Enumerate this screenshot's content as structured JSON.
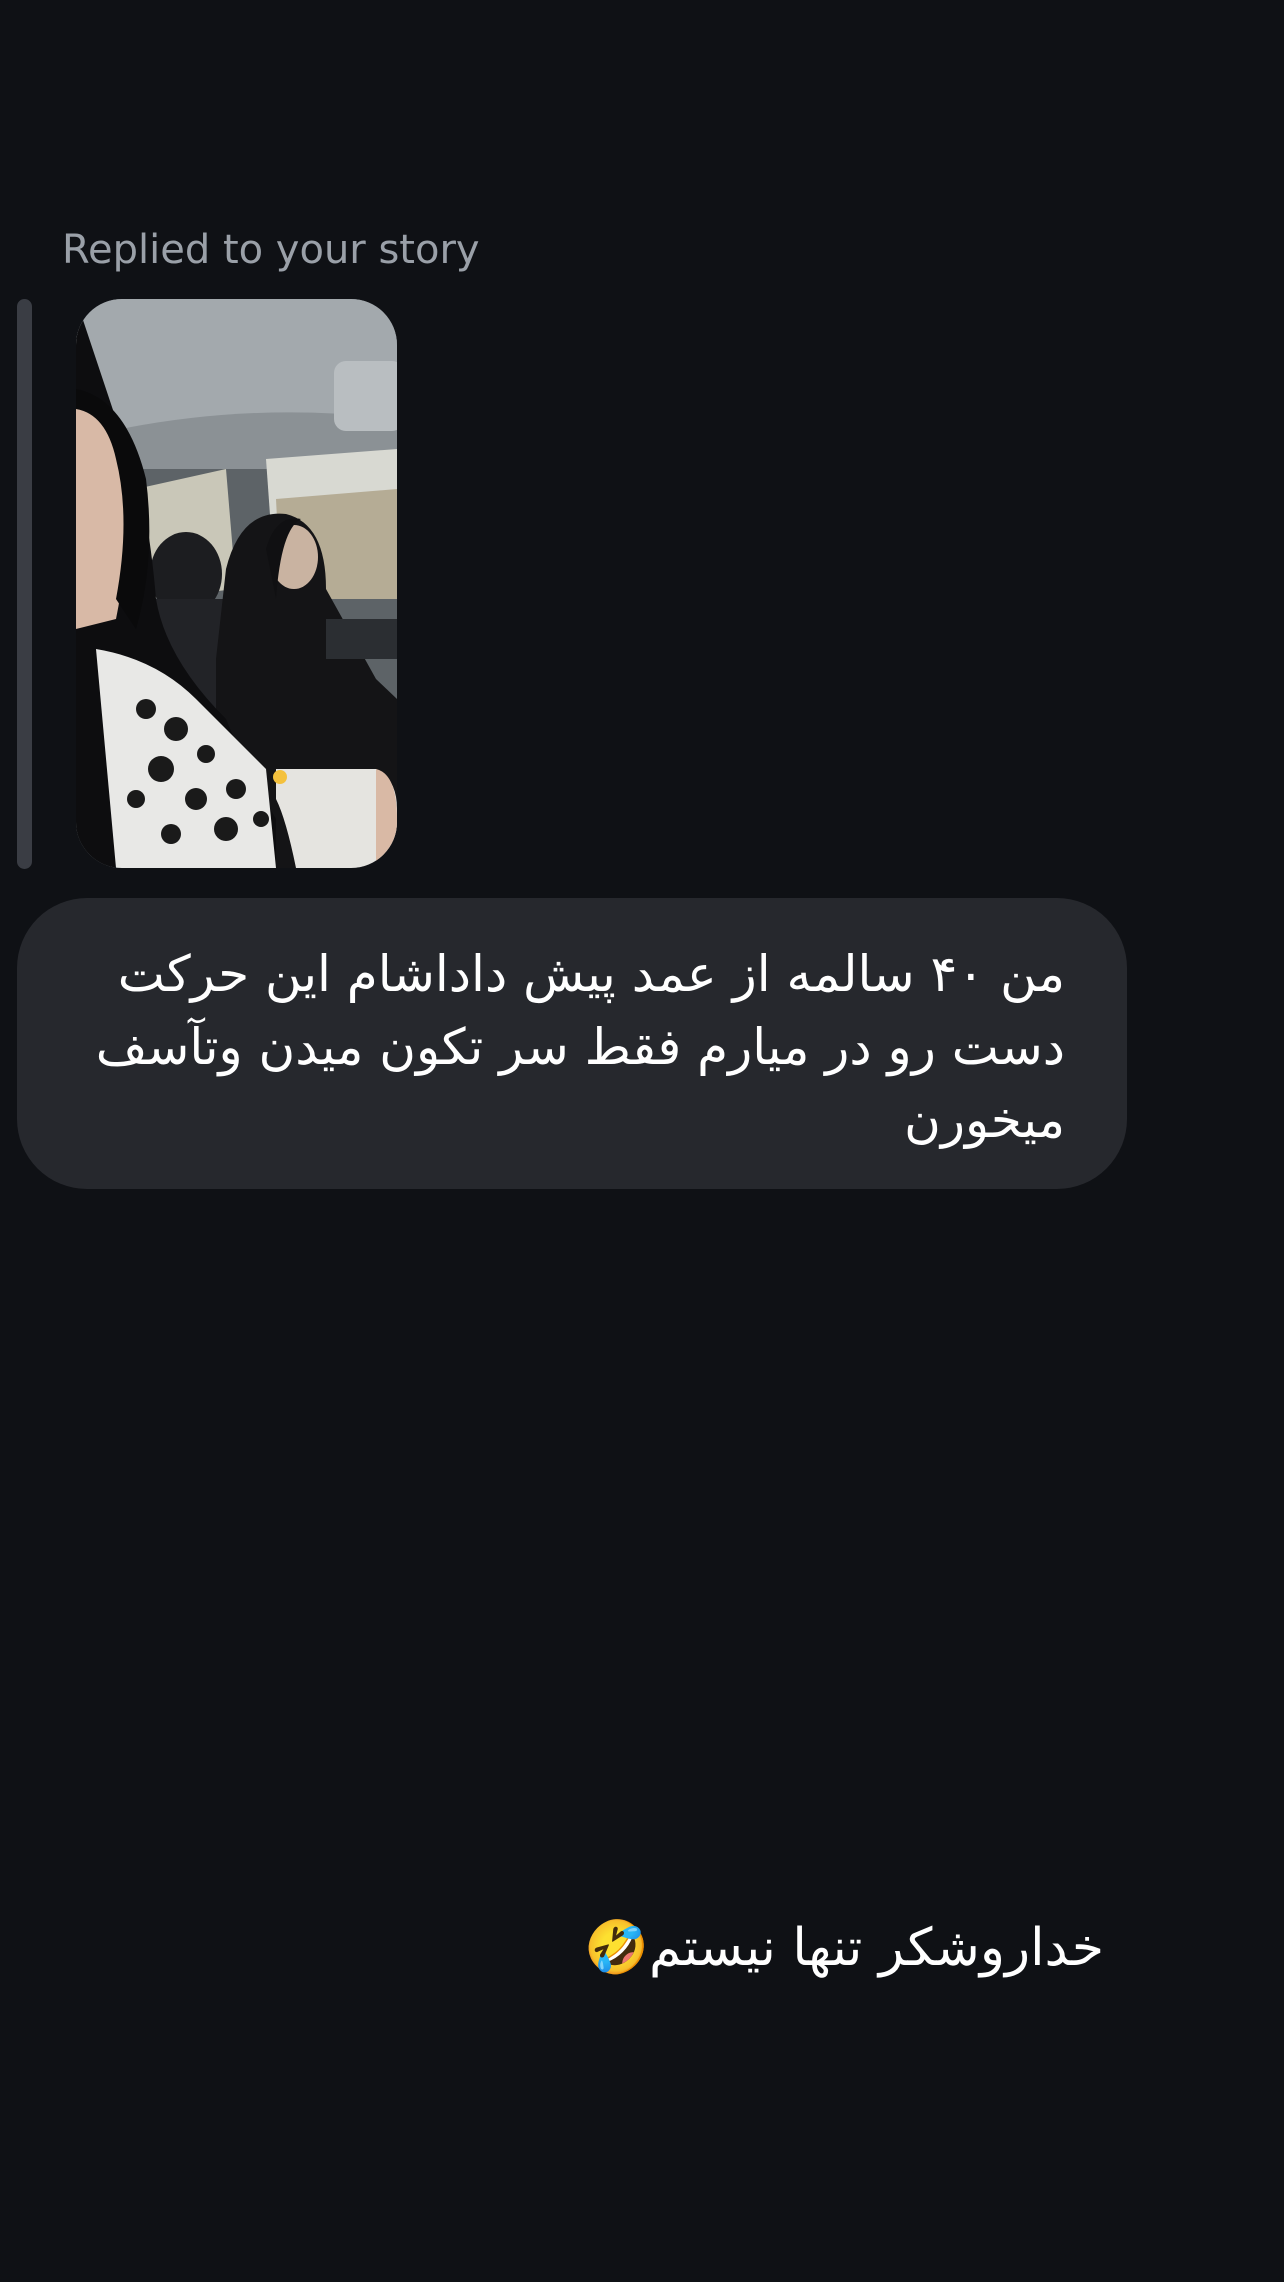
{
  "thread": {
    "reply_label": "Replied to your story",
    "story_thumbnail_icon": "story-photo-thumbnail",
    "incoming_message": "من ۴۰ سالمه از عمد پیش داداشام این حرکت دست رو در میارم فقط سر تکون میدن وتآسف میخورن",
    "outgoing_message": "خداروشکر تنها نیستم🤣"
  },
  "colors": {
    "background": "#0f1115",
    "incoming_bubble": "#26282d",
    "reply_bar": "#3a3d44",
    "secondary_text": "#9aa0a8",
    "primary_text": "#ffffff"
  }
}
